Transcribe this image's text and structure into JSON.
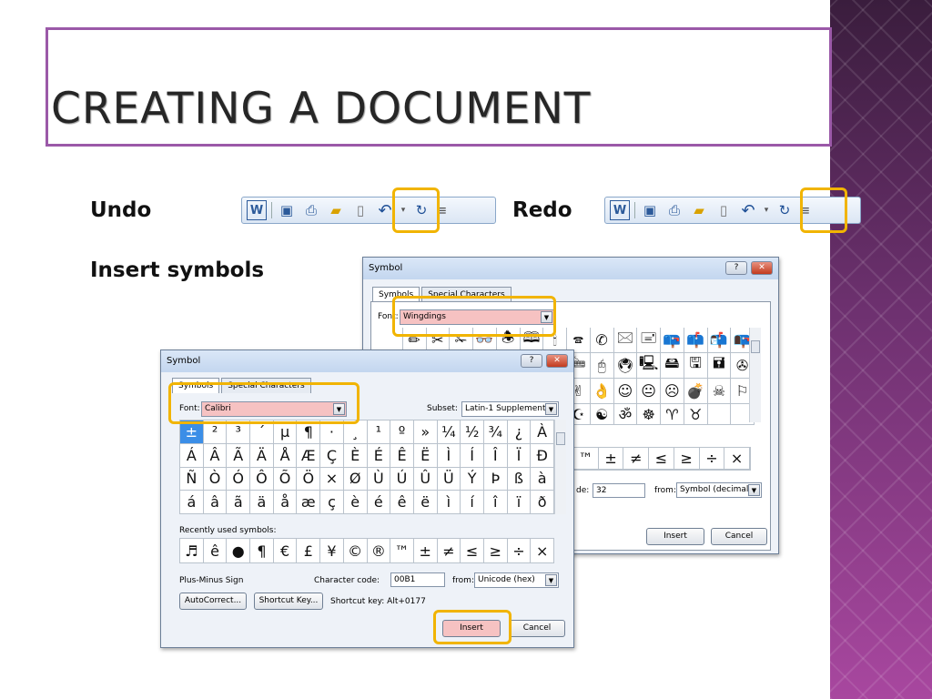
{
  "slide": {
    "title": "CREATING A DOCUMENT",
    "bullets": {
      "undo": "Undo",
      "redo": "Redo",
      "symbols": "Insert symbols"
    }
  },
  "toolbar": {
    "icons": [
      "word-icon",
      "save-icon",
      "print-preview-icon",
      "open-icon",
      "new-doc-icon",
      "undo-icon",
      "redo-icon",
      "customize-icon"
    ],
    "glyphs": {
      "word": "W",
      "save": "▣",
      "print": "⎙",
      "open": "▰",
      "new": "▯",
      "undo": "↶",
      "dropdown": "▾",
      "redo": "↻",
      "customize": "≡"
    }
  },
  "back_dialog": {
    "title": "Symbol",
    "help_label": "?",
    "close_label": "✕",
    "tabs": [
      "Symbols",
      "Special Characters"
    ],
    "font_label": "Font:",
    "font_value": "Wingdings",
    "grid_rows": [
      [
        "",
        "✏",
        "✂",
        "✁",
        "👓",
        "🕭",
        "🕮",
        "🕯",
        "🕿",
        "✆",
        "🖂",
        "🖃",
        "📪",
        "📫",
        "📬",
        "📭"
      ],
      [
        "",
        "",
        "",
        "",
        "",
        "",
        "",
        "🖥",
        "🖮",
        "🖰",
        "🖲",
        "🖳",
        "🖴",
        "🖫",
        "🖬",
        "✇"
      ],
      [
        "",
        "",
        "",
        "",
        "",
        "",
        "",
        "🖎",
        "✌",
        "👌",
        "☺",
        "😐",
        "☹",
        "💣",
        "☠",
        "⚐"
      ],
      [
        "",
        "",
        "",
        "",
        "",
        "",
        "",
        "✡",
        "☪",
        "☯",
        "ॐ",
        "☸",
        "♈",
        "♉",
        "",
        ""
      ]
    ],
    "recent_tail": [
      "™",
      "±",
      "≠",
      "≤",
      "≥",
      "÷",
      "×"
    ],
    "code_label": "de:",
    "code_value": "32",
    "from_label": "from:",
    "from_value": "Symbol (decimal)",
    "insert_label": "Insert",
    "cancel_label": "Cancel"
  },
  "front_dialog": {
    "title": "Symbol",
    "help_label": "?",
    "close_label": "✕",
    "tabs": [
      "Symbols",
      "Special Characters"
    ],
    "font_label": "Font:",
    "font_value": "Calibri",
    "subset_label": "Subset:",
    "subset_value": "Latin-1 Supplement",
    "grid_rows": [
      [
        "±",
        "²",
        "³",
        "´",
        "µ",
        "¶",
        "·",
        "¸",
        "¹",
        "º",
        "»",
        "¼",
        "½",
        "¾",
        "¿",
        "À"
      ],
      [
        "Á",
        "Â",
        "Ã",
        "Ä",
        "Å",
        "Æ",
        "Ç",
        "È",
        "É",
        "Ê",
        "Ë",
        "Ì",
        "Í",
        "Î",
        "Ï",
        "Ð"
      ],
      [
        "Ñ",
        "Ò",
        "Ó",
        "Ô",
        "Õ",
        "Ö",
        "×",
        "Ø",
        "Ù",
        "Ú",
        "Û",
        "Ü",
        "Ý",
        "Þ",
        "ß",
        "à"
      ],
      [
        "á",
        "â",
        "ã",
        "ä",
        "å",
        "æ",
        "ç",
        "è",
        "é",
        "ê",
        "ë",
        "ì",
        "í",
        "î",
        "ï",
        "ð"
      ]
    ],
    "recent_label": "Recently used symbols:",
    "recent": [
      "♬",
      "ê",
      "●",
      "¶",
      "€",
      "£",
      "¥",
      "©",
      "®",
      "™",
      "±",
      "≠",
      "≤",
      "≥",
      "÷",
      "×"
    ],
    "char_name": "Plus-Minus Sign",
    "code_label": "Character code:",
    "code_value": "00B1",
    "from_label": "from:",
    "from_value": "Unicode (hex)",
    "autocorrect_label": "AutoCorrect...",
    "shortcut_key_label": "Shortcut Key...",
    "shortcut_text": "Shortcut key: Alt+0177",
    "insert_label": "Insert",
    "cancel_label": "Cancel"
  },
  "colors": {
    "highlight": "#f1b400",
    "title_border": "#9b59a8",
    "selected_cell": "#3b8ee7",
    "pink_field": "#f6c2c2"
  }
}
